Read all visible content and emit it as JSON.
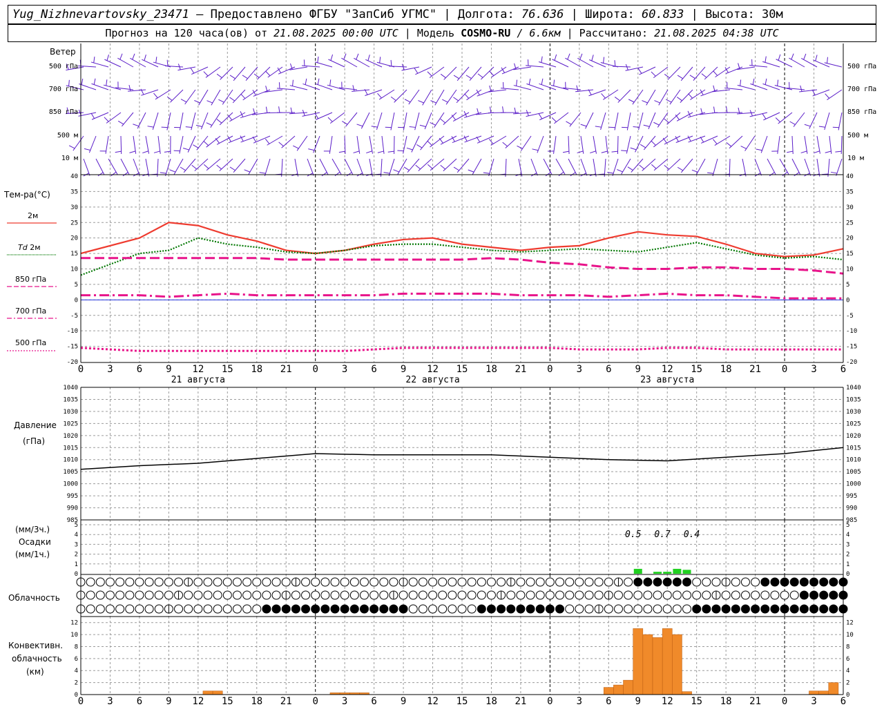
{
  "header": {
    "station": "Yug_Nizhnevartovsky_23471",
    "dash": " – ",
    "provider": "Предоставлено ФГБУ \"ЗапСиб УГМС\"",
    "sep": " | ",
    "lon_label": "Долгота: ",
    "lon": "76.636",
    "lat_label": "Широта: ",
    "lat": "60.833",
    "alt_label": "Высота: ",
    "alt": "30м",
    "forecast_prefix": "Прогноз на 120 часа(ов) от ",
    "forecast_time": "21.08.2025 00:00 UTC",
    "model_label": "  | Модель ",
    "model": "COSMO-RU",
    "resolution": " / 6.6км",
    "computed_label": " | Рассчитано: ",
    "computed_time": "21.08.2025 04:38 UTC"
  },
  "labels": {
    "wind": "Ветер",
    "levels": [
      "500 гПа",
      "700 гПа",
      "850 гПа",
      "500 м",
      "10 м"
    ],
    "temp_title": "Тем-ра(°С)",
    "legend_2m": "2м",
    "legend_td": "Td",
    "legend_td2": "2м",
    "legend_850": "850 гПа",
    "legend_700": "700 гПа",
    "legend_500": "500 гПа",
    "pressure_title": "Давление",
    "pressure_unit": "(гПа)",
    "precip_unit1": "(мм/3ч.)",
    "precip_title": "Осадки",
    "precip_unit2": "(мм/1ч.)",
    "cloud_title": "Облачность",
    "conv_title1": "Конвективн.",
    "conv_title2": "облачность",
    "conv_unit": "(км)"
  },
  "colors": {
    "t2m": "#ee3b2f",
    "td2m": "#007700",
    "t850": "#e8138a",
    "t700": "#e8138a",
    "t500": "#e8138a",
    "wind": "#5a1cc8",
    "precip": "#1fd01f",
    "conv": "#f08a2a",
    "pressure": "#000000"
  },
  "chart_data": [
    {
      "type": "line",
      "title": "Тем-ра(°С)",
      "x_ticks": [
        "0",
        "3",
        "6",
        "9",
        "12",
        "15",
        "18",
        "21",
        "0",
        "3",
        "6",
        "9",
        "12",
        "15",
        "18",
        "21",
        "0",
        "3",
        "6",
        "9",
        "12",
        "15",
        "18",
        "21",
        "0",
        "3",
        "6"
      ],
      "day_labels": [
        "21 августа",
        "22 августа",
        "23 августа"
      ],
      "ylim": [
        -20,
        40
      ],
      "yticks": [
        40,
        35,
        30,
        25,
        20,
        15,
        10,
        5,
        0,
        -5,
        -10,
        -15,
        -20
      ],
      "hours": [
        0,
        6,
        9,
        12,
        15,
        18,
        21,
        24,
        27,
        30,
        33,
        36,
        39,
        42,
        45,
        48,
        51,
        54,
        57,
        60,
        63,
        66,
        69,
        72,
        75,
        78
      ],
      "series": [
        {
          "name": "2м",
          "values": [
            15,
            20,
            25,
            24,
            21,
            19,
            16,
            15,
            16,
            18,
            19.5,
            20,
            18,
            17,
            16,
            17,
            17.5,
            20,
            22,
            21,
            20.5,
            18,
            15,
            14,
            14.5,
            16.5
          ]
        },
        {
          "name": "Td 2м",
          "values": [
            8,
            15,
            16,
            20,
            18,
            17,
            15.5,
            15,
            16,
            17.5,
            18,
            18,
            17,
            16,
            15.5,
            16,
            16.5,
            16,
            15.5,
            17,
            18.5,
            16.5,
            14.5,
            13.5,
            14,
            13
          ]
        },
        {
          "name": "850 гПа",
          "values": [
            13.5,
            13.5,
            13.5,
            13.5,
            13.5,
            13.5,
            13,
            13,
            13,
            13,
            13,
            13,
            13,
            13.5,
            13,
            12,
            11.5,
            10.5,
            10,
            10,
            10.5,
            10.5,
            10,
            10,
            9.5,
            8.5
          ]
        },
        {
          "name": "700 гПа",
          "values": [
            1.5,
            1.5,
            1,
            1.5,
            2,
            1.5,
            1.5,
            1.5,
            1.5,
            1.5,
            2,
            2,
            2,
            2,
            1.5,
            1.5,
            1.5,
            1,
            1.5,
            2,
            1.5,
            1.5,
            1,
            0.5,
            0.5,
            0.5
          ]
        },
        {
          "name": "500 гПа",
          "values": [
            -15.5,
            -16.5,
            -16.5,
            -16.5,
            -16.5,
            -16.5,
            -16.5,
            -16.5,
            -16.5,
            -16,
            -15.5,
            -15.5,
            -15.5,
            -15.5,
            -15.5,
            -15.5,
            -16,
            -16,
            -16,
            -15.5,
            -15.5,
            -16,
            -16,
            -16,
            -16,
            -16
          ]
        }
      ]
    },
    {
      "type": "line",
      "title": "Давление",
      "ylabel": "(гПа)",
      "ylim": [
        985,
        1040
      ],
      "yticks": [
        1040,
        1035,
        1030,
        1025,
        1020,
        1015,
        1010,
        1005,
        1000,
        995,
        990,
        985
      ],
      "hours": [
        0,
        6,
        12,
        18,
        24,
        30,
        36,
        42,
        48,
        54,
        60,
        66,
        72,
        78
      ],
      "values": [
        1006,
        1007.5,
        1008.5,
        1010.5,
        1012.5,
        1012,
        1012,
        1012,
        1011,
        1010,
        1009.5,
        1011,
        1012.5,
        1015
      ]
    },
    {
      "type": "bar",
      "title": "Осадки",
      "ylim": [
        0,
        5
      ],
      "yticks": [
        5,
        4,
        3,
        2,
        1,
        0
      ],
      "labels": [
        "0.5",
        "0.7",
        "0.4"
      ],
      "hours": [
        57,
        59,
        60,
        61,
        62
      ],
      "values": [
        0.5,
        0.2,
        0.2,
        0.5,
        0.4
      ]
    },
    {
      "type": "bar",
      "title": "Конвективн. облачность",
      "ylabel": "(км)",
      "ylim": [
        0,
        13
      ],
      "yticks": [
        12,
        10,
        8,
        6,
        4,
        2,
        0
      ],
      "hours": [
        13,
        14,
        26,
        27,
        28,
        29,
        54,
        55,
        56,
        57,
        58,
        59,
        60,
        61,
        62,
        75,
        76,
        77
      ],
      "values": [
        0.6,
        0.6,
        0.3,
        0.3,
        0.3,
        0.3,
        1.2,
        1.6,
        2.4,
        11,
        10,
        9.5,
        11,
        10,
        0.5,
        0.6,
        0.6,
        2
      ]
    }
  ]
}
